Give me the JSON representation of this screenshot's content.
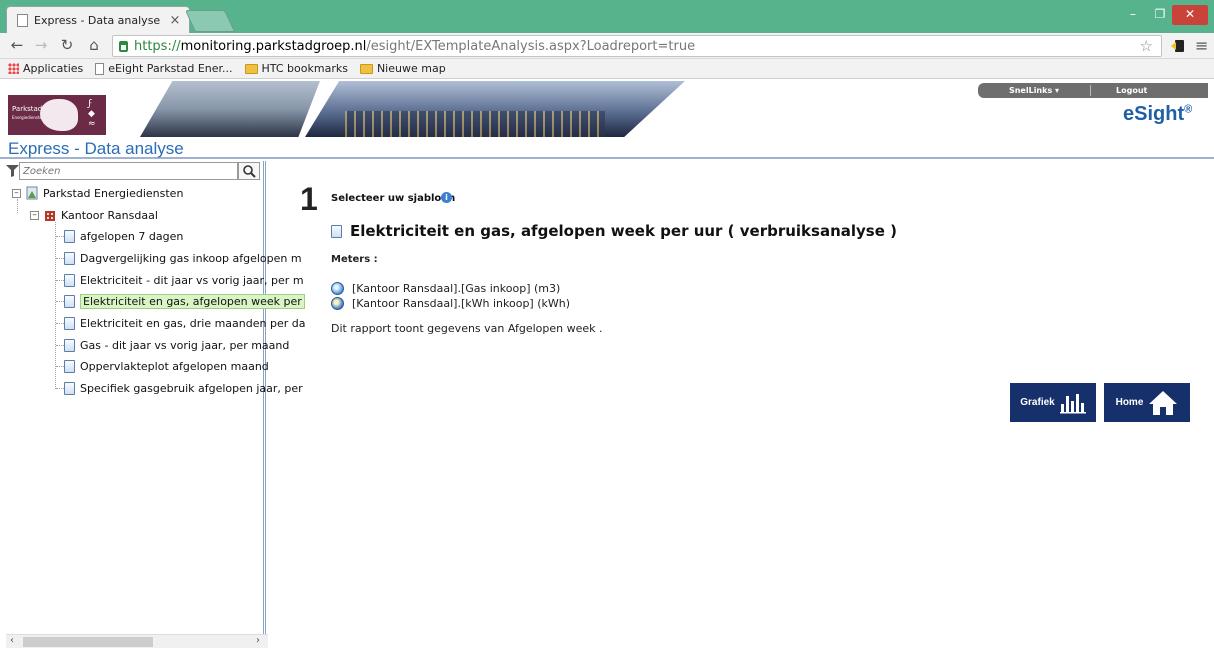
{
  "browser": {
    "tab_title": "Express - Data analyse",
    "tab_close": "×",
    "url_scheme": "https://",
    "url_host": "monitoring.parkstadgroep.nl",
    "url_path": "/esight/EXTemplateAnalysis.aspx?Loadreport=true",
    "bookmarks": [
      {
        "label": "Applicaties",
        "icon": "apps-grid-icon"
      },
      {
        "label": "eEight Parkstad Ener...",
        "icon": "page-icon"
      },
      {
        "label": "HTC bookmarks",
        "icon": "folder-icon"
      },
      {
        "label": "Nieuwe map",
        "icon": "folder-icon"
      }
    ]
  },
  "header": {
    "logo_text": "Parkstad",
    "logo_subtext": "Energiediensten",
    "snellinks": "SnelLinks ▾",
    "logout": "Logout",
    "brand": "eSight",
    "brand_mark": "®",
    "page_title": "Express - Data analyse"
  },
  "sidebar": {
    "search_placeholder": "Zoeken",
    "root": "Parkstad Energiediensten",
    "site": "Kantoor Ransdaal",
    "reports": [
      "afgelopen 7 dagen",
      "Dagvergelijking gas inkoop afgelopen m",
      "Elektriciteit - dit jaar vs vorig jaar, per m",
      "Elektriciteit en gas, afgelopen week per",
      "Elektriciteit en gas, drie maanden per da",
      "Gas - dit jaar vs vorig jaar, per maand",
      "Oppervlakteplot afgelopen maand",
      "Specifiek gasgebruik afgelopen jaar, per"
    ],
    "selected_index": 3
  },
  "main": {
    "step_number": "1",
    "step_label": "Selecteer uw sjabloon",
    "template_name": "Elektriciteit en gas, afgelopen week per uur   ( verbruiksanalyse )",
    "meters_label": "Meters :",
    "meters": [
      "[Kantoor Ransdaal].[Gas inkoop] (m3)",
      "[Kantoor Ransdaal].[kWh inkoop] (kWh)"
    ],
    "report_text": "Dit rapport toont gegevens van Afgelopen week .",
    "grafiek_label": "Grafiek",
    "home_label": "Home"
  }
}
